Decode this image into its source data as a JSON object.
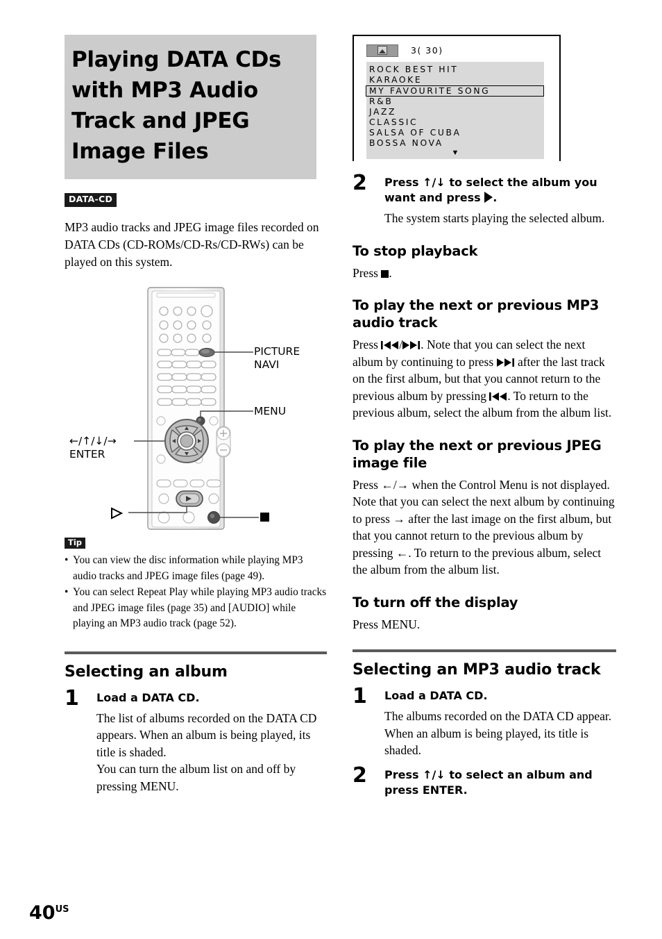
{
  "page": {
    "number": "40",
    "region_suffix": "US"
  },
  "chapter": {
    "title": "Playing DATA CDs with MP3 Audio Track and JPEG Image Files",
    "disc_badge": "DATA-CD",
    "intro": "MP3 audio tracks and JPEG image files recorded on DATA CDs (CD-ROMs/CD-Rs/CD-RWs) can be played on this system."
  },
  "remote": {
    "callouts": {
      "picture_navi": "PICTURE NAVI",
      "menu": "MENU",
      "enter": "ENTER",
      "arrows": "←/↑/↓/→"
    }
  },
  "tip": {
    "badge": "Tip",
    "items": [
      "You can view the disc information while playing MP3 audio tracks and JPEG image files (page 49).",
      "You can select Repeat Play while playing MP3 audio tracks and JPEG image files (page 35) and [AUDIO] while playing an MP3 audio track (page 52)."
    ]
  },
  "selecting_album": {
    "heading": "Selecting an album",
    "step1": {
      "number": "1",
      "title": "Load a DATA CD.",
      "body1": "The list of albums recorded on the DATA CD appears. When an album is being played, its title is shaded.",
      "body2": "You can turn the album list on and off by pressing MENU."
    },
    "step2": {
      "number": "2",
      "title_a": "Press ↑/↓ to select the album you want and press",
      "title_b": ".",
      "body": "The system starts playing the selected album."
    }
  },
  "tv_screen": {
    "counter": "3( 30)",
    "icon": "album-folder-icon",
    "items": [
      "ROCK BEST HIT",
      "KARAOKE",
      "MY FAVOURITE SONG",
      "R&B",
      "JAZZ",
      "CLASSIC",
      "SALSA OF CUBA",
      "BOSSA NOVA"
    ],
    "selected_index": 2,
    "scroll_indicator": "▼"
  },
  "subsections": {
    "stop_playback": {
      "heading": "To stop playback",
      "body_a": "Press",
      "body_b": "."
    },
    "next_prev_mp3": {
      "heading": "To play the next or previous MP3 audio track",
      "p1": "Press",
      "p2": ". Note that you can select the next album by continuing to press",
      "p3": "after the last track on the first album, but that you cannot return to the previous album by pressing",
      "p4": ". To return to the previous album, select the album from the album list."
    },
    "next_prev_jpeg": {
      "heading": "To play the next or previous JPEG image file",
      "p1": "Press ←/→ when the Control Menu is not displayed. Note that you can select the next album by continuing to press → after the last image on the first album, but that you cannot return to the previous album by pressing ←. To return to the previous album, select the album from the album list."
    },
    "turn_off_display": {
      "heading": "To turn off the display",
      "body": "Press MENU."
    }
  },
  "selecting_track": {
    "heading": "Selecting an MP3 audio track",
    "step1": {
      "number": "1",
      "title": "Load a DATA CD.",
      "body": "The albums recorded on the DATA CD appear. When an album is being played, its title is shaded."
    },
    "step2": {
      "number": "2",
      "title": "Press ↑/↓ to select an album and press ENTER."
    }
  },
  "colors": {
    "banner_gray": "#cccccc",
    "rule_gray": "#5a5a5a",
    "list_gray": "#d9d9d9",
    "badge_black": "#1a1a1a"
  }
}
